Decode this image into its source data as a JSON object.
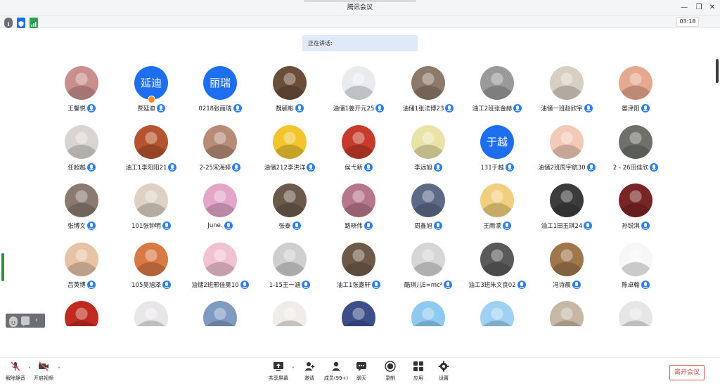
{
  "window": {
    "title": "腾讯会议",
    "minimize_icon": "minimize-icon",
    "restore_icon": "restore-icon",
    "close_icon": "close-icon"
  },
  "infobar": {
    "timer": "03:18",
    "icons": [
      "info-icon",
      "shield-icon",
      "signal-icon"
    ]
  },
  "speaking": {
    "label": "正在讲话:"
  },
  "participants": [
    {
      "name": "王馨悦",
      "avatar_color": "#c98e8e"
    },
    {
      "name": "贾延迪",
      "avatar_text": "延迪",
      "avatar_color": "#1e6ff0",
      "host": true
    },
    {
      "name": "0218张丽瑞",
      "avatar_text": "丽瑞",
      "avatar_color": "#1e6ff0"
    },
    {
      "name": "魏毓彬",
      "avatar_color": "#6b4e3a"
    },
    {
      "name": "油储1姜开元25",
      "avatar_color": "#e8ecef"
    },
    {
      "name": "油储1张法博23",
      "avatar_color": "#8d7a6a"
    },
    {
      "name": "油工2班张金赫",
      "avatar_color": "#9a9a9a"
    },
    {
      "name": "油储一班赵欣宇",
      "avatar_color": "#d8cfc3"
    },
    {
      "name": "晏津阳",
      "avatar_color": "#e6a98f"
    },
    {
      "name": "任超越",
      "avatar_color": "#d9d4cf"
    },
    {
      "name": "油工1李阳阳21",
      "avatar_color": "#b5542e"
    },
    {
      "name": "2-25宋海婷",
      "avatar_color": "#b78b76"
    },
    {
      "name": "油储212李洪洋",
      "avatar_color": "#f2c52e"
    },
    {
      "name": "侯弋新",
      "avatar_color": "#c63b2b"
    },
    {
      "name": "李远旭",
      "avatar_color": "#e9e3a8"
    },
    {
      "name": "131于越",
      "avatar_text": "于越",
      "avatar_color": "#1e6ff0"
    },
    {
      "name": "油储2班周宇航30",
      "avatar_color": "#f3c9b8"
    },
    {
      "name": "2 - 26田佳欣",
      "avatar_color": "#6e7069"
    },
    {
      "name": "张博文",
      "avatar_color": "#8a7a70"
    },
    {
      "name": "101张钟明",
      "avatar_color": "#ddd2c4"
    },
    {
      "name": "June.",
      "avatar_color": "#e3a6c8"
    },
    {
      "name": "张泰",
      "avatar_color": "#6b5a4c"
    },
    {
      "name": "路晓伟",
      "avatar_color": "#b6768c"
    },
    {
      "name": "周鑫旭",
      "avatar_color": "#5d6a87"
    },
    {
      "name": "王雨濛",
      "avatar_color": "#f2cf7e"
    },
    {
      "name": "油工1田玉琪24",
      "avatar_color": "#3c3c3c"
    },
    {
      "name": "孙锐淇",
      "avatar_color": "#7a2525"
    },
    {
      "name": "吕英博",
      "avatar_color": "#e7c3a5"
    },
    {
      "name": "105吴旭泽",
      "avatar_color": "#d97945"
    },
    {
      "name": "油储2班邢佳昊10",
      "avatar_color": "#f1c2d2"
    },
    {
      "name": "1-15王一涵",
      "avatar_color": "#cfcfcf"
    },
    {
      "name": "油工1张嘉轩",
      "avatar_color": "#6f5a4a"
    },
    {
      "name": "酷琪儿E=mc²",
      "avatar_color": "#d6d6d6"
    },
    {
      "name": "油工3班朱文良02",
      "avatar_color": "#5a5a5a"
    },
    {
      "name": "冯诗晨",
      "avatar_color": "#a0764b"
    },
    {
      "name": "陈卓翰",
      "avatar_color": "#f7f7f7"
    },
    {
      "name": "",
      "avatar_color": "#c02a1f"
    },
    {
      "name": "",
      "avatar_color": "#e9e6ea"
    },
    {
      "name": "",
      "avatar_color": "#7f9bc2"
    },
    {
      "name": "",
      "avatar_color": "#f0ece8"
    },
    {
      "name": "",
      "avatar_color": "#3d4f8a"
    },
    {
      "name": "",
      "avatar_color": "#8ecaf0"
    },
    {
      "name": "",
      "avatar_color": "#9fd1f2"
    },
    {
      "name": "",
      "avatar_color": "#c7b8a6"
    },
    {
      "name": "",
      "avatar_color": "#e6e6e6"
    }
  ],
  "toolbar": {
    "unmute": "解除静音",
    "start_video": "开启视频",
    "share_screen": "共享屏幕",
    "invite": "邀请",
    "members": "成员(99+)",
    "chat": "聊天",
    "record": "录制",
    "apps": "应用",
    "settings": "设置",
    "leave": "离开会议"
  },
  "colors": {
    "accent": "#2f80ed",
    "leave": "#e2554f",
    "avatar_blue": "#1e6ff0"
  }
}
